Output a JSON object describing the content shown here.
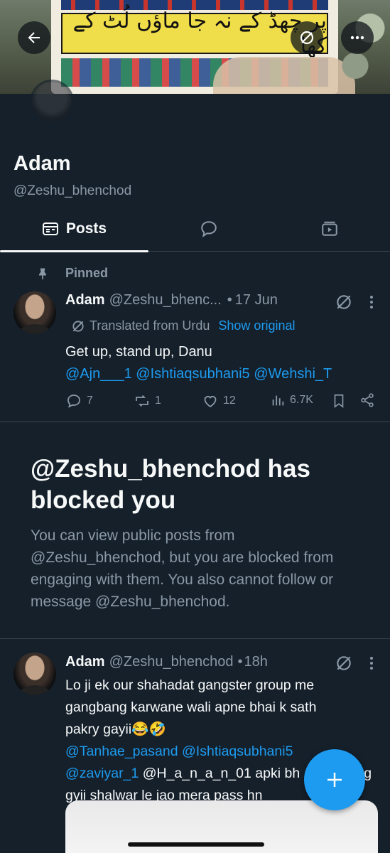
{
  "banner": {
    "urdu_text": "پر چھڈ کے نہ جا  ماؤں لُٹ کے کھا"
  },
  "profile": {
    "name": "Adam",
    "handle": "@Zeshu_bhenchod"
  },
  "tabs": [
    {
      "label": "Posts",
      "icon": "posts-icon",
      "selected": true
    },
    {
      "label": "",
      "icon": "replies-icon",
      "selected": false
    },
    {
      "label": "",
      "icon": "media-icon",
      "selected": false
    }
  ],
  "pinned_post": {
    "pinned_label": "Pinned",
    "author_name": "Adam",
    "author_handle": "@Zeshu_bhenc...",
    "separator": "•",
    "time": "17 Jun",
    "translated_note": "Translated from Urdu",
    "show_original": "Show original",
    "text": "Get up, stand up, Danu",
    "mentions": [
      "@Ajn___1",
      "@Ishtiaqsubhani5",
      "@Wehshi_T"
    ],
    "replies": "7",
    "reposts": "1",
    "likes": "12",
    "views": "6.7K"
  },
  "blocked": {
    "title": "@Zeshu_bhenchod has blocked you",
    "description": "You can view public posts from @Zeshu_bhenchod, but you are blocked from engaging with them. You also cannot follow or message @Zeshu_bhenchod."
  },
  "second_post": {
    "author_name": "Adam",
    "author_handle": "@Zeshu_bhenchod",
    "separator": "•",
    "time": "18h",
    "text_line1": "Lo ji ek our shahadat gangster group me",
    "text_line2": "gangbang karwane wali apne bhai k sath",
    "text_line3": "pakry gayii😂🤣",
    "mention1": "@Tanhae_pasand",
    "mention2": "@Ishtiaqsubhani5",
    "mention3": "@zaviyar_1",
    "mention4": "@H_a_n_a_n_01",
    "text_line5_tail": "apki bh",
    "text_line5_end": "g",
    "text_line6": "gyii shalwar le jao mera pass hn"
  },
  "colors": {
    "background": "#15202b",
    "accent": "#1d9bf0",
    "secondary_text": "#8b98a5",
    "divider": "#38444d"
  }
}
